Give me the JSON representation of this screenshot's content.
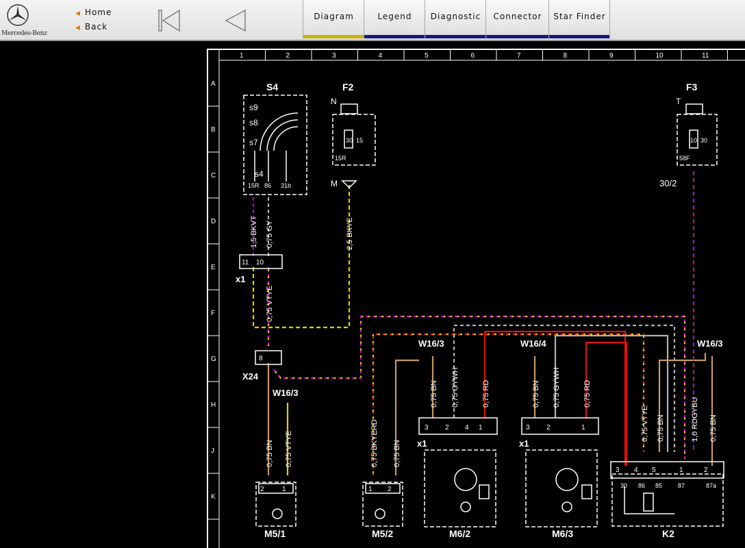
{
  "brand": {
    "name": "Mercedes-Benz"
  },
  "nav": {
    "home_label": "Home",
    "back_label": "Back",
    "first_icon": "skip-to-first-icon",
    "prev_icon": "previous-triangle-icon"
  },
  "tabs": [
    {
      "label": "Diagram",
      "active": true
    },
    {
      "label": "Legend",
      "active": false
    },
    {
      "label": "Diagnostic",
      "active": false
    },
    {
      "label": "Connector",
      "active": false
    },
    {
      "label": "Star Finder",
      "active": false
    }
  ],
  "colors": {
    "accent_active_tab": "#c9b400",
    "tab_underline": "#17177e",
    "wire_red": "#e01010",
    "wire_yellow": "#e0d000",
    "wire_magenta": "#c000c0",
    "wire_blue": "#2040ff",
    "wire_tan": "#c89a64",
    "wire_grey": "#b0b0b0"
  },
  "diagram": {
    "columns": [
      "1",
      "2",
      "3",
      "4",
      "5",
      "6",
      "7",
      "8",
      "9",
      "10",
      "11"
    ],
    "rows": [
      "A",
      "B",
      "C",
      "D",
      "E",
      "F",
      "G",
      "H",
      "J",
      "K"
    ],
    "components": {
      "s4": "S4",
      "f2": "F2",
      "f3": "F3",
      "x1": "x1",
      "x24": "X24",
      "m5_1": "M5/1",
      "m5_2": "M5/2",
      "m6_2": "M6/2",
      "m6_3": "M6/3",
      "k2": "K2",
      "w16_3_a": "W16/3",
      "w16_3_b": "W16/3",
      "w16_4": "W16/4",
      "w16_3_c": "W16/3",
      "x1_m62": "x1",
      "x1_m63": "x1"
    },
    "s4_pins": {
      "s9": "s9",
      "s8": "s8",
      "s7": "s7",
      "s4": "s4",
      "p15r": "15R",
      "p86": "86",
      "p31b": "31b"
    },
    "f2_pins": {
      "n": "N",
      "m": "M",
      "p30": "30",
      "p15": "15",
      "p15r": "15R"
    },
    "f3_pins": {
      "t": "T",
      "p10": "10",
      "p30": "30",
      "p58f": "58F",
      "ref": "30/2"
    },
    "x1_pins": {
      "p11": "11",
      "p10": "10"
    },
    "x24_pin": "8",
    "wires": {
      "w1": "1,5 BKVT",
      "w2": "0,75 GY",
      "w3": "2,5 BKYE",
      "w4": "0,75 VTYE",
      "w5": "0,75 BN",
      "w6": "0,75 VTYE",
      "w7": "0,75 BKYERD",
      "w8": "0,75 BN",
      "w9": "0,75 BN",
      "w10": "0,75 GYWH",
      "w11": "0,75 RD",
      "w12": "0,75 BN",
      "w13": "0,75 GYWH",
      "w14": "0,75 RD",
      "w15": "0,75 VTYE",
      "w16": "0,75 BN",
      "w17": "1,0 RDGYBU",
      "w18": "0,75 BN"
    },
    "m5_1_pins": [
      "2",
      "1"
    ],
    "m5_2_pins": [
      "1",
      "2"
    ],
    "m6_2_pins": [
      "3",
      "2",
      "4",
      "1"
    ],
    "m6_3_pins": [
      "3",
      "2",
      "1"
    ],
    "k2_pins_top": [
      "3",
      "4",
      "5",
      "1",
      "2"
    ],
    "k2_pins_inner": [
      "30",
      "86",
      "85",
      "87",
      "87a"
    ]
  }
}
